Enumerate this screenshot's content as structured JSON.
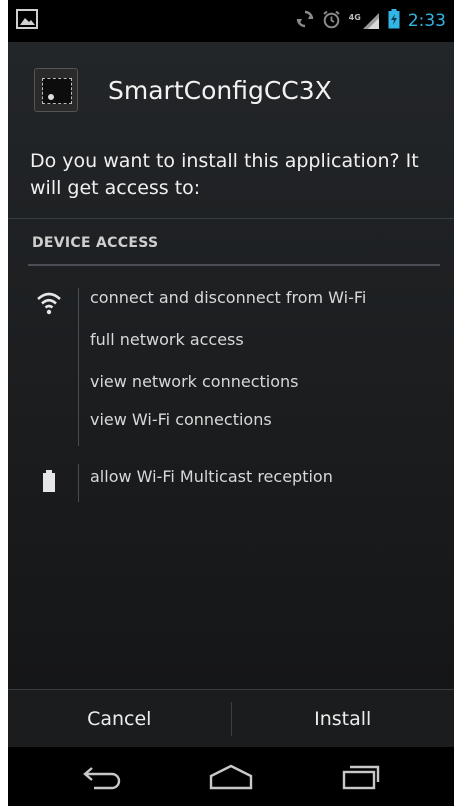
{
  "status_bar": {
    "time": "2:33",
    "network_label": "4G",
    "colors": {
      "clock": "#33b5e5",
      "battery": "#33b5e5"
    },
    "icons": [
      "picture-notification-icon",
      "sync-icon",
      "alarm-icon",
      "signal-icon",
      "battery-icon"
    ]
  },
  "app": {
    "name": "SmartConfigCC3X",
    "icon": "chip-app-icon"
  },
  "prompt": {
    "text": "Do you want to install this application? It will get access to:"
  },
  "permissions": {
    "section_title": "DEVICE ACCESS",
    "groups": [
      {
        "icon": "wifi-icon",
        "items": [
          {
            "label": "connect and disconnect from Wi-Fi"
          },
          {
            "label": "full network access"
          },
          {
            "label": "view network connections"
          },
          {
            "label": "view Wi-Fi connections"
          }
        ]
      },
      {
        "icon": "battery-icon",
        "items": [
          {
            "label": "allow Wi-Fi Multicast reception"
          }
        ]
      }
    ]
  },
  "buttons": {
    "cancel_label": "Cancel",
    "install_label": "Install"
  },
  "nav_bar": {
    "icons": [
      "back-icon",
      "home-icon",
      "recent-apps-icon"
    ]
  }
}
